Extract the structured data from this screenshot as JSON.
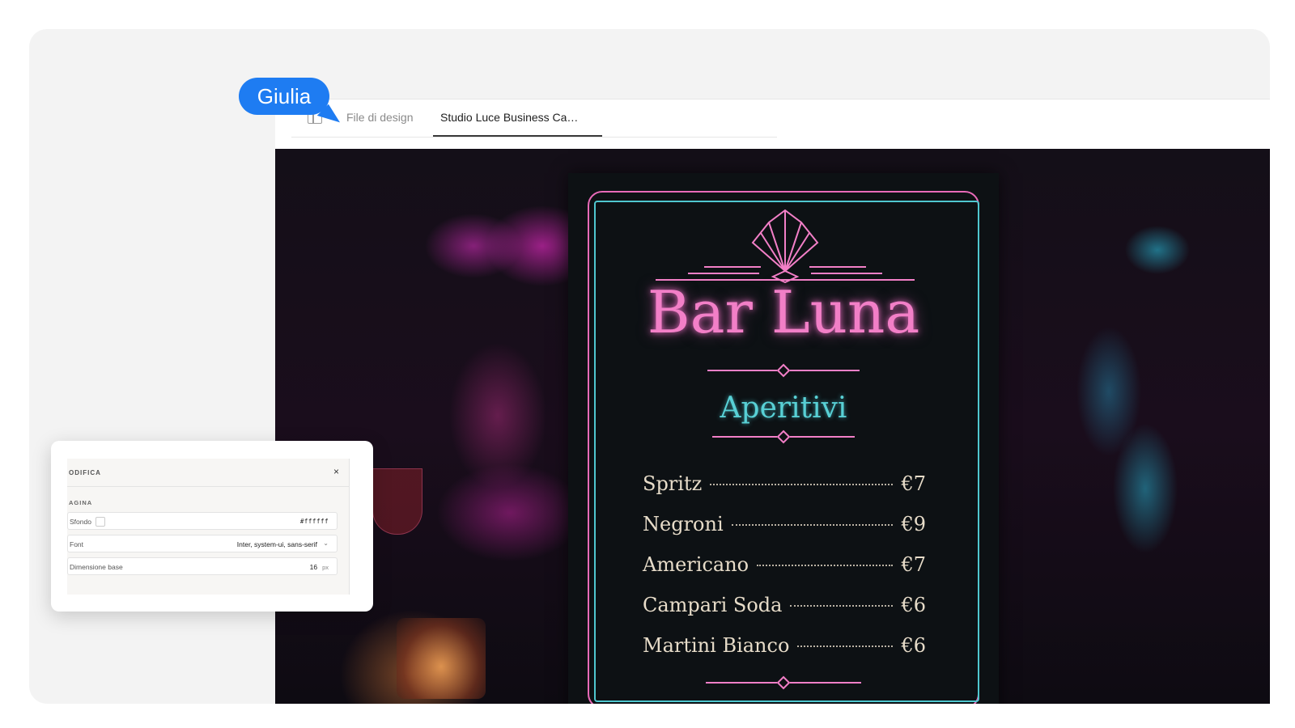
{
  "cursor": {
    "user": "Giulia",
    "color": "#1e7cf2"
  },
  "header": {
    "tabs": [
      {
        "label": "File di design",
        "active": false
      },
      {
        "label": "Studio Luce Business Ca…",
        "active": true
      }
    ]
  },
  "board": {
    "title": "Bar Luna",
    "section": "Aperitivi",
    "items": [
      {
        "name": "Spritz",
        "price": "€7"
      },
      {
        "name": "Negroni",
        "price": "€9"
      },
      {
        "name": "Americano",
        "price": "€7"
      },
      {
        "name": "Campari Soda",
        "price": "€6"
      },
      {
        "name": "Martini Bianco",
        "price": "€6"
      }
    ],
    "colors": {
      "pink": "#f27fc7",
      "cyan": "#58d0d5",
      "text": "#e7dcc9"
    }
  },
  "panel": {
    "title": "ODIFICA",
    "close": "×",
    "section": "AGINA",
    "background": {
      "label": "Sfondo",
      "value": "#ffffff"
    },
    "font": {
      "label": "Font",
      "value": "Inter, system-ui, sans-serif"
    },
    "size": {
      "label": "Dimensione base",
      "value": "16",
      "unit": "px"
    }
  }
}
